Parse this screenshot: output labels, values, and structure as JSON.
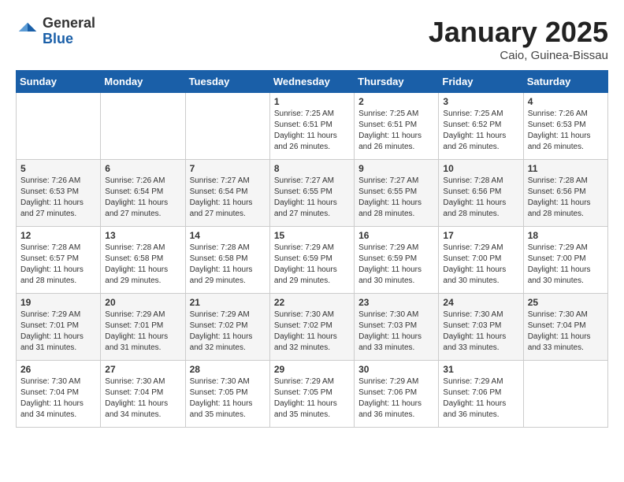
{
  "header": {
    "logo_general": "General",
    "logo_blue": "Blue",
    "month_title": "January 2025",
    "location": "Caio, Guinea-Bissau"
  },
  "weekdays": [
    "Sunday",
    "Monday",
    "Tuesday",
    "Wednesday",
    "Thursday",
    "Friday",
    "Saturday"
  ],
  "weeks": [
    [
      {
        "day": "",
        "sunrise": "",
        "sunset": "",
        "daylight": ""
      },
      {
        "day": "",
        "sunrise": "",
        "sunset": "",
        "daylight": ""
      },
      {
        "day": "",
        "sunrise": "",
        "sunset": "",
        "daylight": ""
      },
      {
        "day": "1",
        "sunrise": "Sunrise: 7:25 AM",
        "sunset": "Sunset: 6:51 PM",
        "daylight": "Daylight: 11 hours and 26 minutes."
      },
      {
        "day": "2",
        "sunrise": "Sunrise: 7:25 AM",
        "sunset": "Sunset: 6:51 PM",
        "daylight": "Daylight: 11 hours and 26 minutes."
      },
      {
        "day": "3",
        "sunrise": "Sunrise: 7:25 AM",
        "sunset": "Sunset: 6:52 PM",
        "daylight": "Daylight: 11 hours and 26 minutes."
      },
      {
        "day": "4",
        "sunrise": "Sunrise: 7:26 AM",
        "sunset": "Sunset: 6:53 PM",
        "daylight": "Daylight: 11 hours and 26 minutes."
      }
    ],
    [
      {
        "day": "5",
        "sunrise": "Sunrise: 7:26 AM",
        "sunset": "Sunset: 6:53 PM",
        "daylight": "Daylight: 11 hours and 27 minutes."
      },
      {
        "day": "6",
        "sunrise": "Sunrise: 7:26 AM",
        "sunset": "Sunset: 6:54 PM",
        "daylight": "Daylight: 11 hours and 27 minutes."
      },
      {
        "day": "7",
        "sunrise": "Sunrise: 7:27 AM",
        "sunset": "Sunset: 6:54 PM",
        "daylight": "Daylight: 11 hours and 27 minutes."
      },
      {
        "day": "8",
        "sunrise": "Sunrise: 7:27 AM",
        "sunset": "Sunset: 6:55 PM",
        "daylight": "Daylight: 11 hours and 27 minutes."
      },
      {
        "day": "9",
        "sunrise": "Sunrise: 7:27 AM",
        "sunset": "Sunset: 6:55 PM",
        "daylight": "Daylight: 11 hours and 28 minutes."
      },
      {
        "day": "10",
        "sunrise": "Sunrise: 7:28 AM",
        "sunset": "Sunset: 6:56 PM",
        "daylight": "Daylight: 11 hours and 28 minutes."
      },
      {
        "day": "11",
        "sunrise": "Sunrise: 7:28 AM",
        "sunset": "Sunset: 6:56 PM",
        "daylight": "Daylight: 11 hours and 28 minutes."
      }
    ],
    [
      {
        "day": "12",
        "sunrise": "Sunrise: 7:28 AM",
        "sunset": "Sunset: 6:57 PM",
        "daylight": "Daylight: 11 hours and 28 minutes."
      },
      {
        "day": "13",
        "sunrise": "Sunrise: 7:28 AM",
        "sunset": "Sunset: 6:58 PM",
        "daylight": "Daylight: 11 hours and 29 minutes."
      },
      {
        "day": "14",
        "sunrise": "Sunrise: 7:28 AM",
        "sunset": "Sunset: 6:58 PM",
        "daylight": "Daylight: 11 hours and 29 minutes."
      },
      {
        "day": "15",
        "sunrise": "Sunrise: 7:29 AM",
        "sunset": "Sunset: 6:59 PM",
        "daylight": "Daylight: 11 hours and 29 minutes."
      },
      {
        "day": "16",
        "sunrise": "Sunrise: 7:29 AM",
        "sunset": "Sunset: 6:59 PM",
        "daylight": "Daylight: 11 hours and 30 minutes."
      },
      {
        "day": "17",
        "sunrise": "Sunrise: 7:29 AM",
        "sunset": "Sunset: 7:00 PM",
        "daylight": "Daylight: 11 hours and 30 minutes."
      },
      {
        "day": "18",
        "sunrise": "Sunrise: 7:29 AM",
        "sunset": "Sunset: 7:00 PM",
        "daylight": "Daylight: 11 hours and 30 minutes."
      }
    ],
    [
      {
        "day": "19",
        "sunrise": "Sunrise: 7:29 AM",
        "sunset": "Sunset: 7:01 PM",
        "daylight": "Daylight: 11 hours and 31 minutes."
      },
      {
        "day": "20",
        "sunrise": "Sunrise: 7:29 AM",
        "sunset": "Sunset: 7:01 PM",
        "daylight": "Daylight: 11 hours and 31 minutes."
      },
      {
        "day": "21",
        "sunrise": "Sunrise: 7:29 AM",
        "sunset": "Sunset: 7:02 PM",
        "daylight": "Daylight: 11 hours and 32 minutes."
      },
      {
        "day": "22",
        "sunrise": "Sunrise: 7:30 AM",
        "sunset": "Sunset: 7:02 PM",
        "daylight": "Daylight: 11 hours and 32 minutes."
      },
      {
        "day": "23",
        "sunrise": "Sunrise: 7:30 AM",
        "sunset": "Sunset: 7:03 PM",
        "daylight": "Daylight: 11 hours and 33 minutes."
      },
      {
        "day": "24",
        "sunrise": "Sunrise: 7:30 AM",
        "sunset": "Sunset: 7:03 PM",
        "daylight": "Daylight: 11 hours and 33 minutes."
      },
      {
        "day": "25",
        "sunrise": "Sunrise: 7:30 AM",
        "sunset": "Sunset: 7:04 PM",
        "daylight": "Daylight: 11 hours and 33 minutes."
      }
    ],
    [
      {
        "day": "26",
        "sunrise": "Sunrise: 7:30 AM",
        "sunset": "Sunset: 7:04 PM",
        "daylight": "Daylight: 11 hours and 34 minutes."
      },
      {
        "day": "27",
        "sunrise": "Sunrise: 7:30 AM",
        "sunset": "Sunset: 7:04 PM",
        "daylight": "Daylight: 11 hours and 34 minutes."
      },
      {
        "day": "28",
        "sunrise": "Sunrise: 7:30 AM",
        "sunset": "Sunset: 7:05 PM",
        "daylight": "Daylight: 11 hours and 35 minutes."
      },
      {
        "day": "29",
        "sunrise": "Sunrise: 7:29 AM",
        "sunset": "Sunset: 7:05 PM",
        "daylight": "Daylight: 11 hours and 35 minutes."
      },
      {
        "day": "30",
        "sunrise": "Sunrise: 7:29 AM",
        "sunset": "Sunset: 7:06 PM",
        "daylight": "Daylight: 11 hours and 36 minutes."
      },
      {
        "day": "31",
        "sunrise": "Sunrise: 7:29 AM",
        "sunset": "Sunset: 7:06 PM",
        "daylight": "Daylight: 11 hours and 36 minutes."
      },
      {
        "day": "",
        "sunrise": "",
        "sunset": "",
        "daylight": ""
      }
    ]
  ]
}
